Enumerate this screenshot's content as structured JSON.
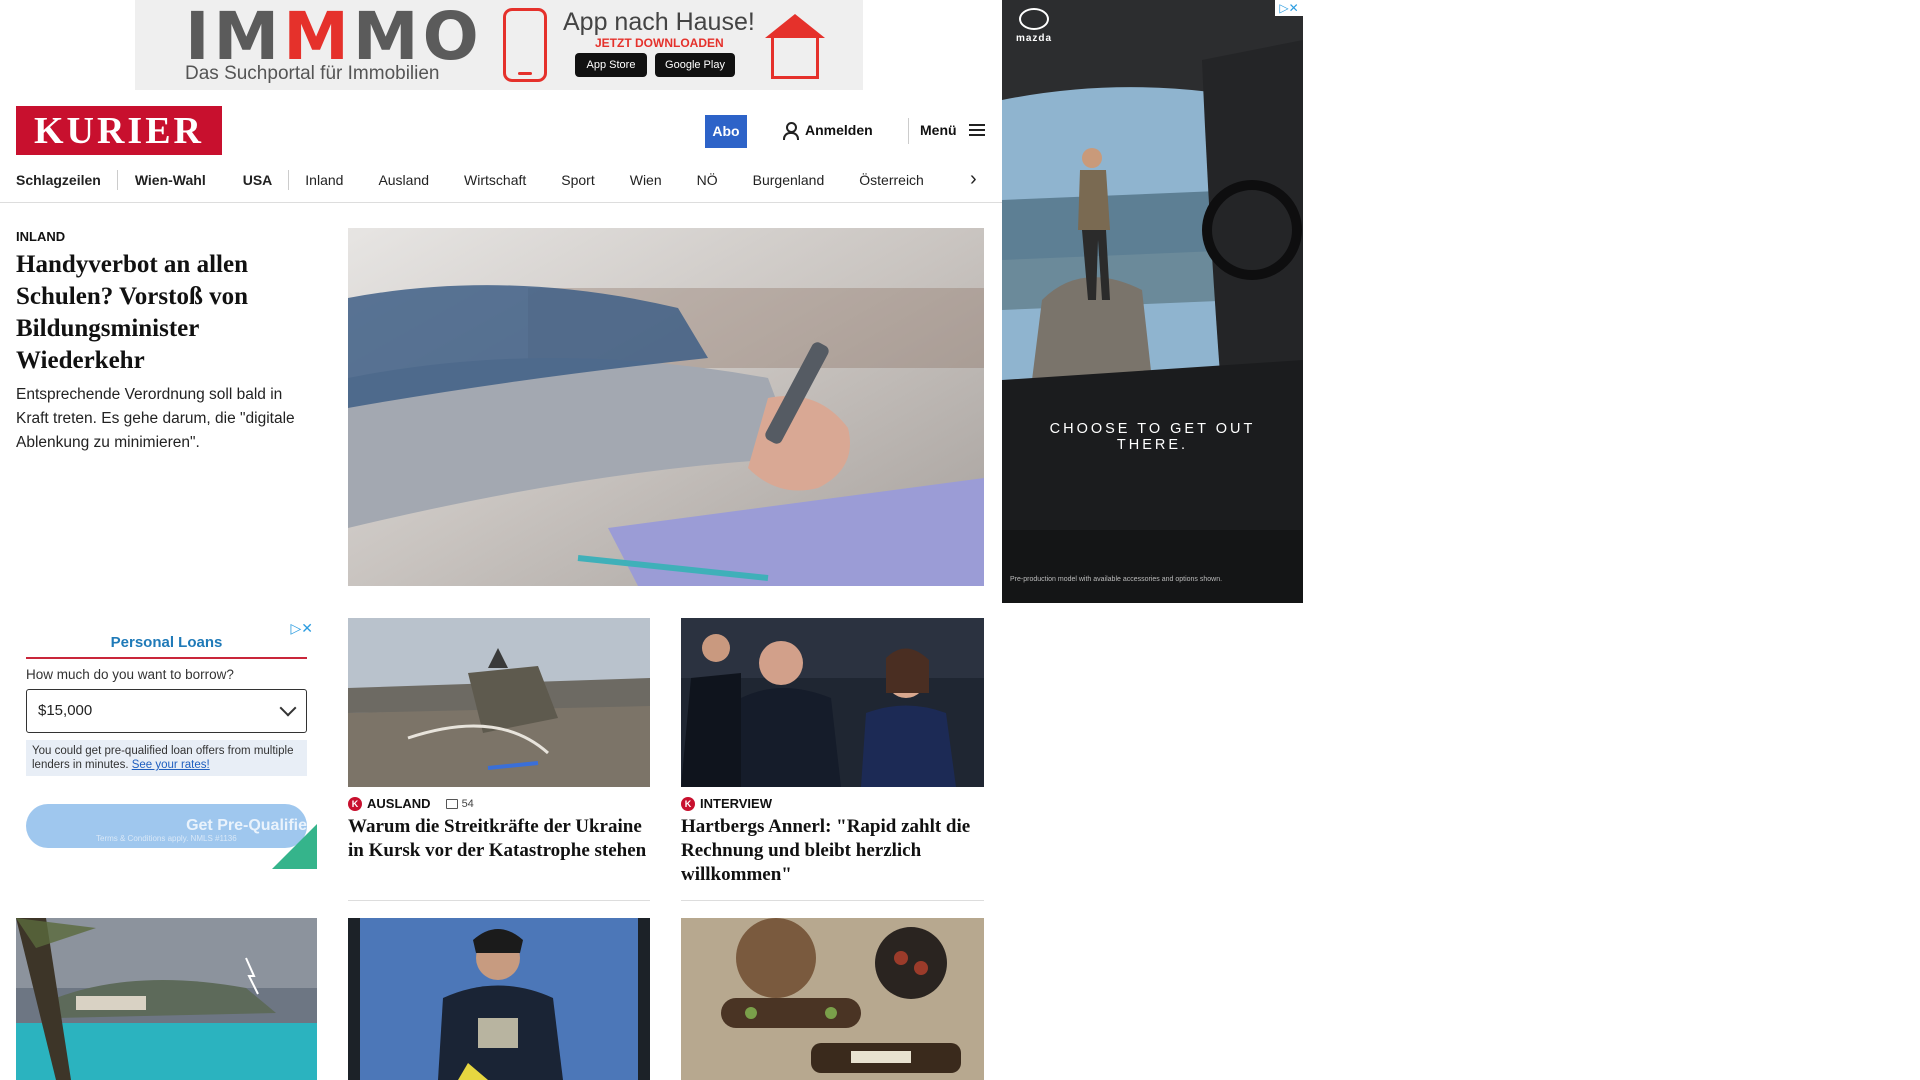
{
  "top_ad": {
    "brand_part1": "IM",
    "brand_part2": "M",
    "brand_part3": "MO",
    "tagline": "Das Suchportal für Immobilien",
    "headline": "App nach Hause!",
    "cta": "JETZT DOWNLOADEN",
    "store_apple": "App Store",
    "store_google": "Google Play"
  },
  "header": {
    "logo": "KURIER",
    "abo": "Abo",
    "login": "Anmelden",
    "menu": "Menü"
  },
  "nav": {
    "items": [
      "Schlagzeilen",
      "Wien-Wahl",
      "USA",
      "Inland",
      "Ausland",
      "Wirtschaft",
      "Sport",
      "Wien",
      "NÖ",
      "Burgenland",
      "Österreich"
    ],
    "arrow": "›"
  },
  "lead": {
    "category": "INLAND",
    "title": "Handyverbot an allen Schulen? Vorstoß von Bildungsminister Wiederkehr",
    "teaser": "Entsprechende Verordnung soll bald in Kraft treten. Es gehe darum, die \"digitale Ablenkung zu minimieren\"."
  },
  "loan_ad": {
    "title": "Personal Loans",
    "question": "How much do you want to borrow?",
    "amount": "$15,000",
    "info": "You could get pre-qualified loan offers from multiple lenders in minutes.",
    "info_link": "See your rates!",
    "cta": "Get Pre-Qualifie",
    "fine_print": "Terms & Conditions apply. NMLS #1136"
  },
  "cards": [
    {
      "category": "AUSLAND",
      "badge": "K",
      "comments": "54",
      "title": "Warum die Streitkräfte der Ukraine in Kursk vor der Katastrophe stehen"
    },
    {
      "category": "INTERVIEW",
      "badge": "K",
      "title": "Hartbergs Annerl: \"Rapid zahlt die Rechnung und bleibt herzlich willkommen\""
    }
  ],
  "side_ad": {
    "brand": "mazda",
    "tagline_line1": "CHOOSE TO GET OUT",
    "tagline_line2": "THERE.",
    "disclaimer": "Pre-production model with available accessories and options shown."
  },
  "colors": {
    "kurier_red": "#c8102e",
    "abo_blue": "#2d63c8",
    "immo_red": "#e5312b"
  }
}
